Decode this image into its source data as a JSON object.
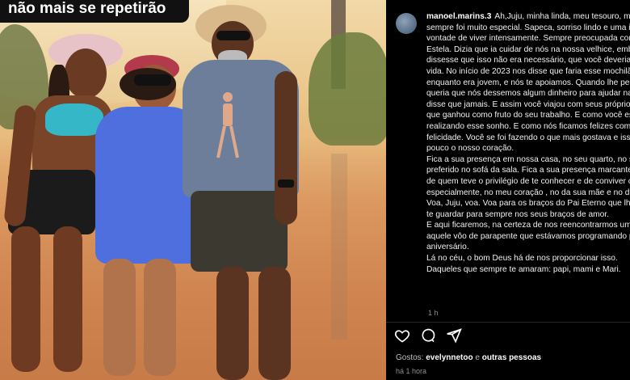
{
  "photo": {
    "caption": "não mais se repetirão"
  },
  "post": {
    "username": "manoel.marins.3",
    "comment": "Ah,Juju, minha linda, meu tesouro, meu amor. Você sempre foi muito especial. Sapeca, sorriso lindo e uma imensa vontade de viver intensamente. Sempre preocupada comigo e com a Estela. Dizia que ia cuidar de nós na nossa velhice, embora eu lhe dissesse que isso não era necessário, que você deveria viver a sua vida. No início de 2023 nos disse que faria esse mochilão agora enquanto era jovem, e nós te apoiamos. Quando lhe perguntei se queria que nós dessemos algum dinheiro para ajudar na viagem, você disse que jamais. E assim você viajou com seus próprios recursos, que ganhou como fruto do seu trabalho. E como você estava feliz realizando esse sonho. E como nós ficamos felizes com a sua felicidade. Você se foi fazendo o que mais gostava e isso acalma um pouco o nosso coração.\nFica a sua presença em nossa casa, no seu quarto, no seu lugar preferido no sofá da sala. Fica a sua presença marcante no coração de quem teve o privilégio de te conhecer e de conviver com você. E, especialmente, no meu coração , no da sua mãe e no da sua irmã.\nVoa, Juju, voa. Voa para os braços do Pai Eterno que lhe espera para te guardar para sempre nos seus braços de amor.\nE aqui ficaremos, na certeza de nos reencontrarmos um dia e fazer aquele vôo de parapente que estávamos programando para o seu aniversário.\nLá no céu, o bom Deus há de nos proporcionar isso.\nDaqueles que sempre te amaram: papi, mami e Mari.",
    "comment_time": "1 h",
    "likes_prefix": "Gostos: ",
    "likes_user": "evelynnetoo",
    "likes_conj": " e ",
    "likes_others": "outras pessoas",
    "posted_ago": "há 1 hora"
  }
}
